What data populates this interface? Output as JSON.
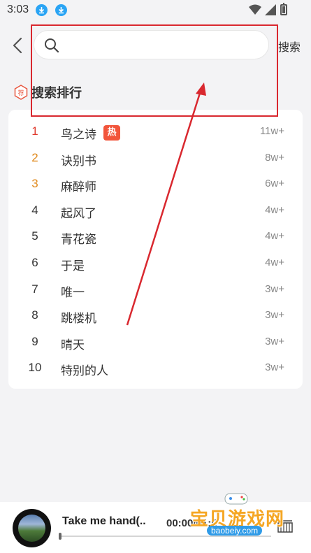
{
  "status_bar": {
    "time": "3:03"
  },
  "header": {
    "search_placeholder": "",
    "search_button": "搜索"
  },
  "section": {
    "title": "搜索排行",
    "badge_glyph": "荐"
  },
  "ranking": [
    {
      "rank": "1",
      "name": "鸟之诗",
      "count": "11w+",
      "hot": "热",
      "color": "#e03b2e"
    },
    {
      "rank": "2",
      "name": "诀别书",
      "count": "8w+",
      "hot": "",
      "color": "#e08a1e"
    },
    {
      "rank": "3",
      "name": "麻醉师",
      "count": "6w+",
      "hot": "",
      "color": "#e08a1e"
    },
    {
      "rank": "4",
      "name": "起风了",
      "count": "4w+",
      "hot": "",
      "color": "#333333"
    },
    {
      "rank": "5",
      "name": "青花瓷",
      "count": "4w+",
      "hot": "",
      "color": "#333333"
    },
    {
      "rank": "6",
      "name": "于是",
      "count": "4w+",
      "hot": "",
      "color": "#333333"
    },
    {
      "rank": "7",
      "name": "唯一",
      "count": "3w+",
      "hot": "",
      "color": "#333333"
    },
    {
      "rank": "8",
      "name": "跳楼机",
      "count": "3w+",
      "hot": "",
      "color": "#333333"
    },
    {
      "rank": "9",
      "name": "晴天",
      "count": "3w+",
      "hot": "",
      "color": "#333333"
    },
    {
      "rank": "10",
      "name": "特别的人",
      "count": "3w+",
      "hot": "",
      "color": "#333333"
    }
  ],
  "player": {
    "title": "Take me hand(..",
    "time": "00:00/01:5",
    "progress": 0
  },
  "watermark": {
    "text": "宝贝游戏网",
    "url": "baobeiy.com"
  },
  "colors": {
    "annotation": "#d9282f",
    "hot_badge": "#f2553b",
    "download_icon": "#2aa4f4"
  }
}
